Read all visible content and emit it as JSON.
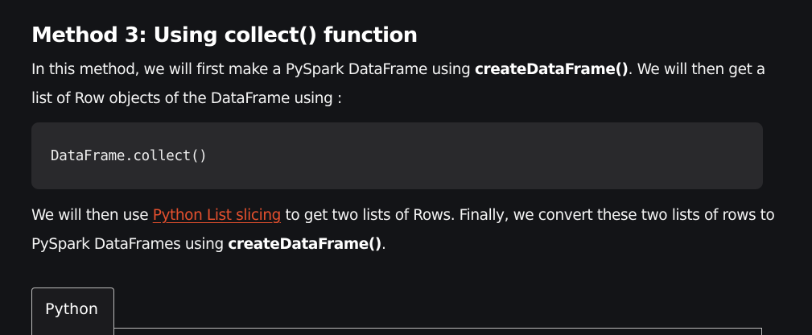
{
  "heading": "Method 3: Using collect() function",
  "paragraph1": {
    "text_before": "In this method, we will first make a PySpark DataFrame using ",
    "bold": "createDataFrame()",
    "text_after": ". We will then get a list of Row objects of the DataFrame using :"
  },
  "code_block": {
    "code": "DataFrame.collect()"
  },
  "paragraph2": {
    "text_before": "We will then use ",
    "link": "Python List slicing",
    "text_middle": " to get two lists of Rows. Finally, we convert these two lists of rows to PySpark DataFrames using ",
    "bold": "createDataFrame()",
    "text_after": "."
  },
  "tabs": [
    {
      "label": "Python",
      "active": true
    }
  ],
  "colors": {
    "background": "#131417",
    "code_background": "#29292c",
    "link": "#e5502e",
    "text": "#f4f4f4"
  }
}
